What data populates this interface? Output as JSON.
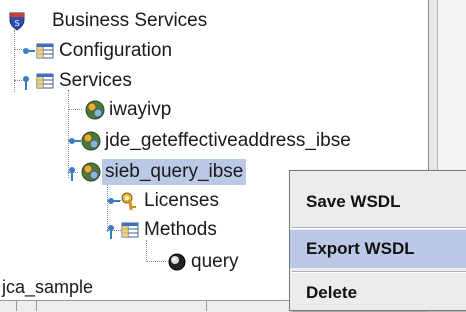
{
  "tree": {
    "root_label": "Business Services",
    "configuration_label": "Configuration",
    "services_label": "Services",
    "services": [
      {
        "label": "iwayivp"
      },
      {
        "label": "jde_geteffectiveaddress_ibse"
      },
      {
        "label": "sieb_query_ibse"
      }
    ],
    "licenses_label": "Licenses",
    "methods_label": "Methods",
    "query_label": "query",
    "bottom_label": "jca_sample"
  },
  "context_menu": {
    "items": [
      {
        "label": "Save WSDL"
      },
      {
        "label": "Export WSDL"
      },
      {
        "label": "Delete"
      }
    ]
  },
  "colors": {
    "selection": "#bcc9e6",
    "menu_bg": "#ececec"
  }
}
